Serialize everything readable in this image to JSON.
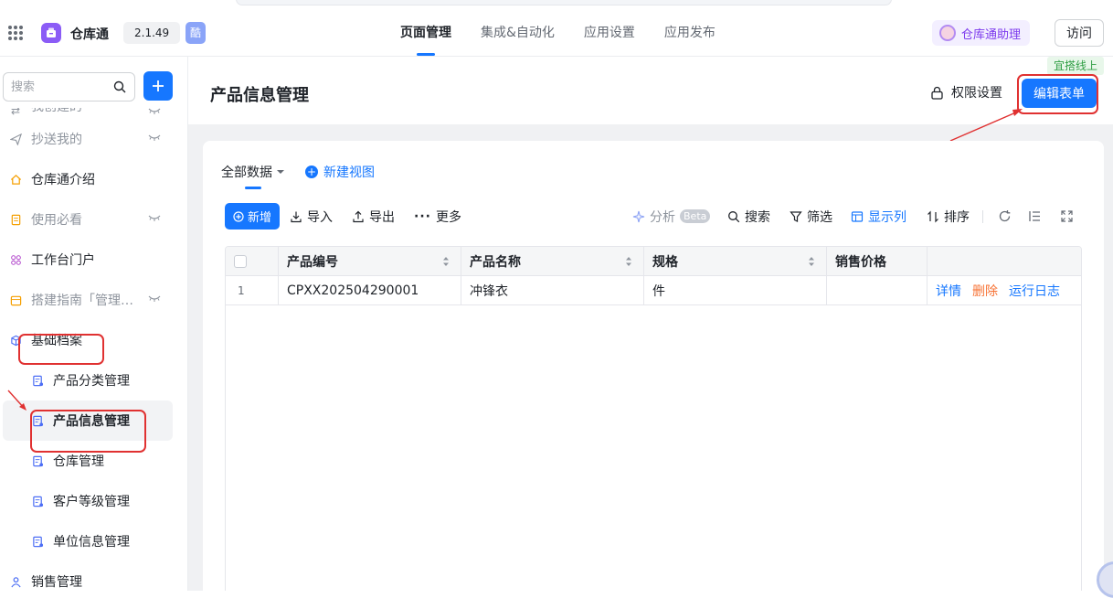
{
  "header": {
    "app_name": "仓库通",
    "version": "2.1.49",
    "badge": "酷",
    "tabs": [
      {
        "label": "页面管理",
        "active": true
      },
      {
        "label": "集成&自动化",
        "active": false
      },
      {
        "label": "应用设置",
        "active": false
      },
      {
        "label": "应用发布",
        "active": false
      }
    ],
    "assistant_label": "仓库通助理",
    "visit_label": "访问"
  },
  "sidebar": {
    "search_placeholder": "搜索",
    "items": [
      {
        "label": "我创建的",
        "icon": "share-icon",
        "hidden_eye": true
      },
      {
        "label": "抄送我的",
        "icon": "send-icon",
        "hidden_eye": true
      },
      {
        "label": "仓库通介绍",
        "icon": "home-icon",
        "hidden_eye": false
      },
      {
        "label": "使用必看",
        "icon": "doc-icon",
        "hidden_eye": true
      },
      {
        "label": "工作台门户",
        "icon": "apps-icon",
        "hidden_eye": false
      },
      {
        "label": "搭建指南「管理员可见」",
        "icon": "calendar-icon",
        "hidden_eye": true
      },
      {
        "label": "基础档案",
        "icon": "cube-icon",
        "hidden_eye": false
      },
      {
        "label": "产品分类管理",
        "icon": "form-icon",
        "hidden_eye": false
      },
      {
        "label": "产品信息管理",
        "icon": "form-icon",
        "hidden_eye": false
      },
      {
        "label": "仓库管理",
        "icon": "form-icon",
        "hidden_eye": false
      },
      {
        "label": "客户等级管理",
        "icon": "form-icon",
        "hidden_eye": false
      },
      {
        "label": "单位信息管理",
        "icon": "form-icon",
        "hidden_eye": false
      },
      {
        "label": "销售管理",
        "icon": "person-icon",
        "hidden_eye": false
      }
    ]
  },
  "main": {
    "page_title": "产品信息管理",
    "permission_label": "权限设置",
    "edit_form_label": "编辑表单",
    "hint_tag": "宜搭线上",
    "view_all_label": "全部数据",
    "new_view_label": "新建视图",
    "toolbar": {
      "new": "新增",
      "import": "导入",
      "export": "导出",
      "more": "更多",
      "analyze": "分析",
      "beta": "Beta",
      "search": "搜索",
      "filter": "筛选",
      "show_columns": "显示列",
      "sort": "排序"
    },
    "table": {
      "columns": [
        "产品编号",
        "产品名称",
        "规格",
        "销售价格"
      ],
      "rows": [
        {
          "index": "1",
          "code": "CPXX202504290001",
          "name": "冲锋衣",
          "spec": "件",
          "price": ""
        }
      ],
      "row_actions": [
        "详情",
        "删除",
        "运行日志"
      ]
    }
  },
  "colors": {
    "primary": "#1677ff",
    "annotation_red": "#e03131",
    "delete": "#f77234",
    "app_logo": "#8b5cf6"
  }
}
